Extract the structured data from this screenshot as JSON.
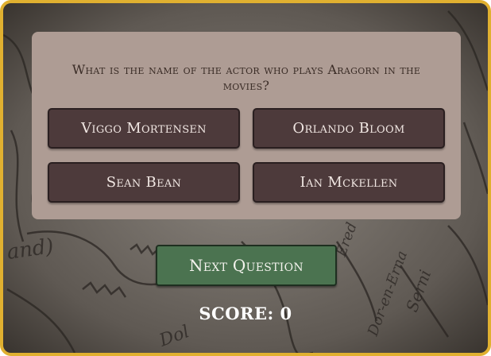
{
  "quiz": {
    "question": "What is the name of the actor who plays Aragorn in the movies?",
    "answers": [
      "Viggo Mortensen",
      "Orlando Bloom",
      "Sean Bean",
      "Ian Mckellen"
    ]
  },
  "controls": {
    "next_label": "Next Question"
  },
  "score": {
    "label": "SCORE: 0"
  },
  "background": {
    "map_labels": [
      "and)",
      "Dol",
      "Ered",
      "Dor-en-Erna",
      "Serni"
    ]
  },
  "colors": {
    "frame_border": "#e0b030",
    "card_bg": "#ae9c94",
    "answer_bg": "#4d3a3b",
    "next_bg": "#4b7350",
    "score_text": "#ffffff"
  }
}
